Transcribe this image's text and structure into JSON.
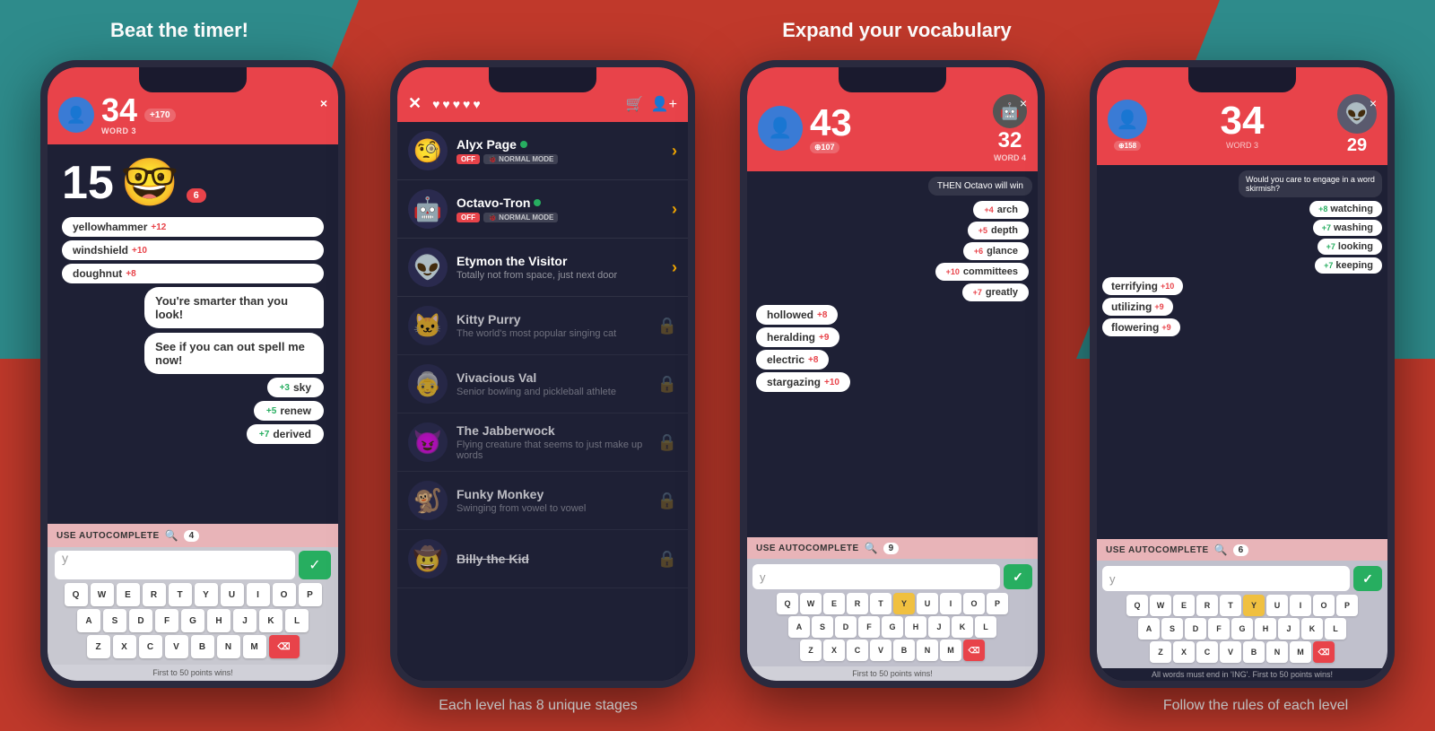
{
  "captions": {
    "top": [
      "Beat the timer!",
      "",
      "Expand your vocabulary",
      ""
    ],
    "bottom": [
      "",
      "Each level has 8 unique stages",
      "",
      "Follow the rules of each level"
    ]
  },
  "phone1": {
    "header": {
      "score": "34",
      "word_label": "WORD 3",
      "pts_badge": "+170",
      "close": "×"
    },
    "timer": "15",
    "timer_badge": "6",
    "chat_messages": [
      "You're smarter than you look!",
      "See if you can out spell me now!"
    ],
    "words_left": [
      {
        "word": "yellowhammer",
        "pts": "+12"
      },
      {
        "word": "windshield",
        "pts": "+10"
      },
      {
        "word": "doughnut",
        "pts": "+8"
      }
    ],
    "words_right": [
      {
        "pts": "+3",
        "word": "sky"
      },
      {
        "pts": "+5",
        "word": "renew"
      },
      {
        "pts": "+7",
        "word": "derived"
      }
    ],
    "autocomplete_label": "USE AUTOCOMPLETE",
    "autocomplete_count": "4",
    "input_placeholder": "y",
    "keyboard_rows": [
      [
        "Q",
        "W",
        "E",
        "R",
        "T",
        "Y",
        "U",
        "I",
        "O",
        "P"
      ],
      [
        "A",
        "S",
        "D",
        "F",
        "G",
        "H",
        "J",
        "K",
        "L"
      ],
      [
        "Z",
        "X",
        "C",
        "V",
        "B",
        "N",
        "M",
        "⌫"
      ]
    ],
    "footer": "First to 50 points wins!"
  },
  "phone2": {
    "hearts": [
      "♥",
      "♥",
      "♥",
      "♥",
      "♥"
    ],
    "opponents": [
      {
        "name": "Alyx Page",
        "online": true,
        "mode_off": "OFF",
        "mode": "NORMAL MODE",
        "desc": "",
        "locked": false,
        "emoji": "🧐"
      },
      {
        "name": "Octavo-Tron",
        "online": true,
        "mode_off": "OFF",
        "mode": "NORMAL MODE",
        "desc": "",
        "locked": false,
        "emoji": "🤖"
      },
      {
        "name": "Etymon the Visitor",
        "online": false,
        "desc": "Totally not from space, just next door",
        "locked": false,
        "emoji": "👽"
      },
      {
        "name": "Kitty Purry",
        "online": false,
        "desc": "The world's most popular singing cat",
        "locked": true,
        "emoji": "🐱"
      },
      {
        "name": "Vivacious Val",
        "online": false,
        "desc": "Senior bowling and pickleball athlete",
        "locked": true,
        "emoji": "👵"
      },
      {
        "name": "The Jabberwock",
        "online": false,
        "desc": "Flying creature that seems to just make up words",
        "locked": true,
        "emoji": "😈"
      },
      {
        "name": "Funky Monkey",
        "online": false,
        "desc": "Swinging from vowel to vowel",
        "locked": true,
        "emoji": "🐒"
      },
      {
        "name": "Billy the Kid",
        "online": false,
        "desc": "",
        "locked": true,
        "emoji": "🤠"
      }
    ]
  },
  "phone3": {
    "player_score": "43",
    "player_pts_badge": "107",
    "opp_score": "32",
    "word_label": "WORD 4",
    "close": "×",
    "opp_bubble": "THEN Octavo will win",
    "words_right": [
      {
        "pts": "+4",
        "word": "arch"
      },
      {
        "pts": "+5",
        "word": "depth"
      },
      {
        "pts": "+6",
        "word": "glance"
      },
      {
        "pts": "+10",
        "word": "committees"
      },
      {
        "pts": "+7",
        "word": "greatly"
      }
    ],
    "words_left": [
      {
        "word": "hollowed",
        "pts": "+8"
      },
      {
        "word": "heralding",
        "pts": "+9"
      },
      {
        "word": "electric",
        "pts": "+8"
      },
      {
        "word": "stargazing",
        "pts": "+10"
      }
    ],
    "autocomplete_label": "USE AUTOCOMPLETE",
    "autocomplete_count": "9",
    "input_placeholder": "y",
    "keyboard_rows": [
      [
        "Q",
        "W",
        "E",
        "R",
        "T",
        "Y",
        "U",
        "I",
        "O",
        "P"
      ],
      [
        "A",
        "S",
        "D",
        "F",
        "G",
        "H",
        "J",
        "K",
        "L"
      ],
      [
        "Z",
        "X",
        "C",
        "V",
        "B",
        "N",
        "M",
        "⌫"
      ]
    ],
    "footer": "First to 50 points wins!"
  },
  "phone4": {
    "player_score": "34",
    "word_label": "WORD 3",
    "player_pts_badge": "158",
    "opp_score": "29",
    "close": "×",
    "opp_chat": "Would you care to engage in a word skirmish?",
    "words_right": [
      {
        "pts": "+8",
        "word": "watching"
      },
      {
        "pts": "+7",
        "word": "washing"
      },
      {
        "pts": "+7",
        "word": "looking"
      },
      {
        "pts": "+7",
        "word": "keeping"
      }
    ],
    "words_left": [
      {
        "word": "terrifying",
        "pts": "+10"
      },
      {
        "word": "utilizing",
        "pts": "+9"
      },
      {
        "word": "flowering",
        "pts": "+9"
      }
    ],
    "autocomplete_label": "USE AUTOCOMPLETE",
    "autocomplete_count": "6",
    "input_placeholder": "y",
    "keyboard_rows": [
      [
        "Q",
        "W",
        "E",
        "R",
        "T",
        "Y",
        "U",
        "I",
        "O",
        "P"
      ],
      [
        "A",
        "S",
        "D",
        "F",
        "G",
        "H",
        "J",
        "K",
        "L"
      ],
      [
        "Z",
        "X",
        "C",
        "V",
        "B",
        "N",
        "M",
        "⌫"
      ]
    ],
    "rule_text": "All words must end in 'ING'. First to 50 points wins!",
    "footer": "First to 50 points wins!"
  }
}
